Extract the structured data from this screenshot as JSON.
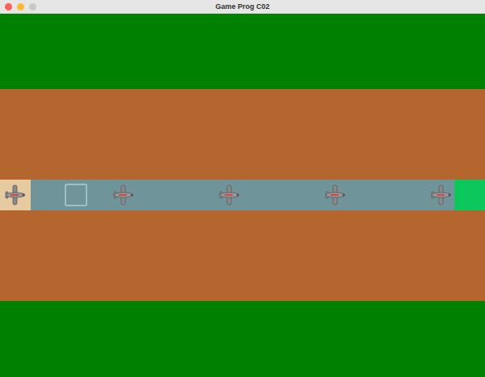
{
  "window": {
    "title": "Game Prog C02"
  },
  "map": {
    "rows": [
      {
        "kind": "grass"
      },
      {
        "kind": "dirt"
      },
      {
        "kind": "path"
      },
      {
        "kind": "dirt"
      },
      {
        "kind": "grass"
      }
    ]
  },
  "path": {
    "spawn": {
      "occupied": true
    },
    "goal": {
      "reached": false
    },
    "cursor_cell": {
      "highlighted": true
    },
    "enemies": [
      {
        "kind": "plane"
      },
      {
        "kind": "plane"
      },
      {
        "kind": "plane"
      },
      {
        "kind": "plane"
      }
    ]
  }
}
